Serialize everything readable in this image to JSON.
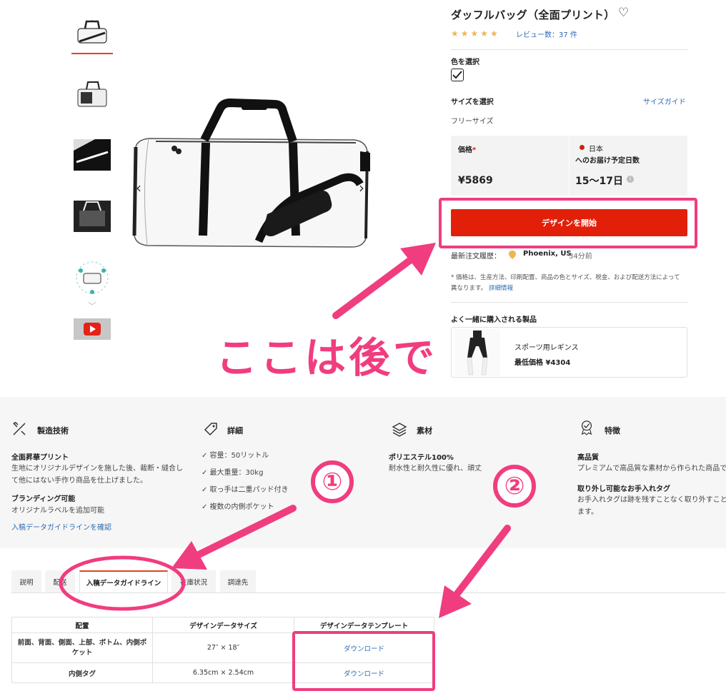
{
  "product": {
    "title": "ダッフルバッグ（全面プリント）",
    "stars": "★★★★★",
    "reviews": "レビュー数：37 件"
  },
  "color": {
    "label": "色を選択"
  },
  "size": {
    "label": "サイズを選択",
    "guide_link": "サイズガイド",
    "value": "フリーサイズ"
  },
  "price": {
    "label": "価格",
    "required_mark": "*",
    "value": "¥5869"
  },
  "delivery": {
    "country": "日本",
    "label": "へのお届け予定日数",
    "days": "15〜17日",
    "info_icon": "info-icon"
  },
  "design_button": {
    "label": "デザインを開始"
  },
  "recent_order": {
    "label": "最新注文履歴：",
    "location": "Phoenix, US",
    "time": "34分前"
  },
  "price_note": {
    "line1": "* 価格は、生産方法、印刷配置、商品の色とサイズ、税金、および配送方法によって",
    "line2": "異なります。",
    "link": "詳細情報"
  },
  "related": {
    "heading": "よく一緒に購入される製品",
    "name": "スポーツ用レギンス",
    "price": "最低価格 ¥4304"
  },
  "annotation": {
    "main": "ここは後で",
    "num1": "①",
    "num2": "②",
    "color": "#f03d7f"
  },
  "features": {
    "tech": {
      "title": "製造技術",
      "sub1": "全面昇華プリント",
      "line1": "生地にオリジナルデザインを施した後、裁断・縫合し",
      "line2": "て他にはない手作り商品を仕上げました。",
      "sub2": "ブランディング可能",
      "line3": "オリジナルラベルを追加可能",
      "link": "入稿データガイドラインを確認"
    },
    "details": {
      "title": "詳細",
      "items": [
        "✓ 容量：50リットル",
        "✓ 最大重量：30kg",
        "✓ 取っ手は二重パッド付き",
        "✓ 複数の内側ポケット"
      ]
    },
    "material": {
      "title": "素材",
      "sub": "ポリエステル100%",
      "line": "耐水性と耐久性に優れ、頑丈"
    },
    "traits": {
      "title": "特徴",
      "sub1": "高品質",
      "line1": "プレミアムで高品質な素材から作られた商品で",
      "sub2": "取り外し可能なお手入れタグ",
      "line2": "お手入れタグは跡を残すことなく取り外すこと",
      "line3": "ます。"
    }
  },
  "tabs": [
    "説明",
    "配送",
    "入稿データガイドライン",
    "在庫状況",
    "調達先"
  ],
  "table": {
    "headers": [
      "配置",
      "デザインデータサイズ",
      "デザインデータテンプレート"
    ],
    "rows": [
      {
        "placement_l1": "前面、背面、側面、上部、ボトム、内側ポ",
        "placement_l2": "ケット",
        "size": "27″ × 18″",
        "template": "ダウンロード"
      },
      {
        "placement": "内側タグ",
        "size": "6.35cm × 2.54cm",
        "template": "ダウンロード"
      }
    ]
  },
  "colors": {
    "accent": "#e2200a",
    "link": "#2d6bb3",
    "star": "#f0b552"
  }
}
